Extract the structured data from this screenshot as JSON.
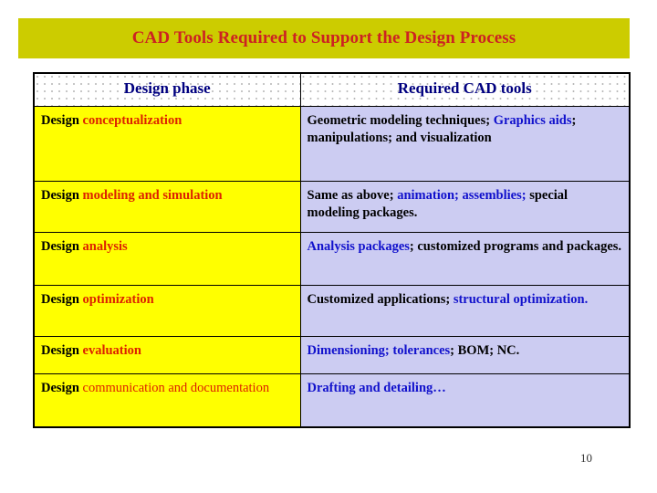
{
  "slide": {
    "title": "CAD Tools Required to Support the Design Process",
    "page_number": "10",
    "colors": {
      "banner_background": "#cccc00",
      "title_text": "#cc2222",
      "header_text": "#000080",
      "phase_column_background": "#ffff00",
      "tools_column_background": "#ccccf2",
      "accent_red": "#dd2200",
      "accent_blue": "#1111cc",
      "text_black": "#000000"
    }
  },
  "table": {
    "headers": {
      "phase": "Design phase",
      "tools": "Required CAD tools"
    },
    "rows": [
      {
        "phase_parts": [
          {
            "text": "Design ",
            "color": "black"
          },
          {
            "text": "conceptualization",
            "color": "red"
          }
        ],
        "tools_parts": [
          {
            "text": "Geometric modeling techniques; ",
            "color": "black"
          },
          {
            "text": "Graphics aids",
            "color": "blue"
          },
          {
            "text": ";  manipulations; and visualization",
            "color": "black"
          }
        ],
        "phase_plain": "Design conceptualization",
        "tools_plain": "Geometric modeling techniques; Graphics aids;  manipulations; and visualization"
      },
      {
        "phase_parts": [
          {
            "text": "Design ",
            "color": "black"
          },
          {
            "text": "modeling and simulation",
            "color": "red"
          }
        ],
        "tools_parts": [
          {
            "text": "Same as above; ",
            "color": "black"
          },
          {
            "text": "animation; assemblies;",
            "color": "blue"
          },
          {
            "text": " special modeling packages.",
            "color": "black"
          }
        ],
        "phase_plain": "Design modeling and simulation",
        "tools_plain": "Same as above; animation; assemblies; special modeling packages."
      },
      {
        "phase_parts": [
          {
            "text": "Design ",
            "color": "black"
          },
          {
            "text": "analysis",
            "color": "red"
          }
        ],
        "tools_parts": [
          {
            "text": "Analysis packages",
            "color": "blue"
          },
          {
            "text": "; customized programs and packages.",
            "color": "black"
          }
        ],
        "phase_plain": "Design analysis",
        "tools_plain": "Analysis packages; customized programs and packages."
      },
      {
        "phase_parts": [
          {
            "text": "Design ",
            "color": "black"
          },
          {
            "text": "optimization",
            "color": "red"
          }
        ],
        "tools_parts": [
          {
            "text": "Customized applications; ",
            "color": "black"
          },
          {
            "text": "structural optimization.",
            "color": "blue"
          }
        ],
        "phase_plain": "Design optimization",
        "tools_plain": "Customized applications; structural optimization."
      },
      {
        "phase_parts": [
          {
            "text": "Design ",
            "color": "black"
          },
          {
            "text": "evaluation",
            "color": "red"
          }
        ],
        "tools_parts": [
          {
            "text": "Dimensioning; tolerances",
            "color": "blue"
          },
          {
            "text": "; BOM; NC.",
            "color": "black"
          }
        ],
        "phase_plain": "Design evaluation",
        "tools_plain": "Dimensioning; tolerances; BOM; NC."
      },
      {
        "phase_parts": [
          {
            "text": "Design ",
            "color": "black"
          },
          {
            "text": "communication and documentation",
            "color": "red",
            "normal_weight": true
          }
        ],
        "tools_parts": [
          {
            "text": "Drafting and detailing…",
            "color": "blue"
          }
        ],
        "phase_plain": "Design communication and documentation",
        "tools_plain": "Drafting and detailing…"
      }
    ]
  }
}
